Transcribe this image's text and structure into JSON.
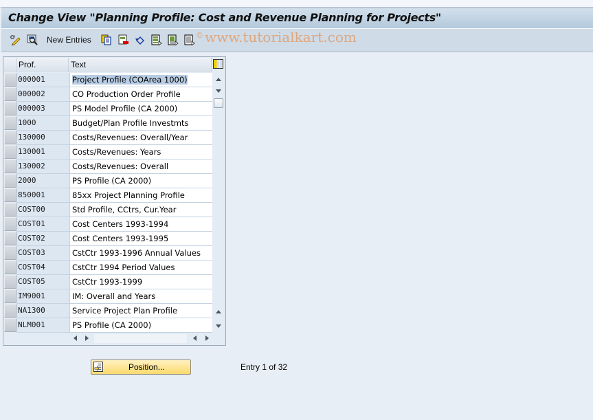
{
  "window": {
    "title": "Change View \"Planning Profile: Cost and Revenue Planning for Projects\""
  },
  "toolbar": {
    "icons": [
      "change-display-icon",
      "details-icon",
      "copy-as-icon",
      "delete-icon",
      "undo-change-icon",
      "select-all-icon",
      "select-block-icon",
      "deselect-all-icon"
    ],
    "new_entries_label": "New Entries",
    "watermark": "www.tutorialkart.com",
    "watermark_symbol": "©"
  },
  "table": {
    "columns": [
      {
        "key": "prof",
        "label": "Prof."
      },
      {
        "key": "text",
        "label": "Text"
      }
    ],
    "rows": [
      {
        "prof": "000001",
        "text": "Project Profile (COArea 1000)",
        "selected": true
      },
      {
        "prof": "000002",
        "text": "CO Production Order Profile"
      },
      {
        "prof": "000003",
        "text": "PS Model Profile (CA 2000)"
      },
      {
        "prof": "1000",
        "text": "Budget/Plan Profile Investmts"
      },
      {
        "prof": "130000",
        "text": "Costs/Revenues: Overall/Year"
      },
      {
        "prof": "130001",
        "text": "Costs/Revenues: Years"
      },
      {
        "prof": "130002",
        "text": "Costs/Revenues: Overall"
      },
      {
        "prof": "2000",
        "text": "PS Profile (CA 2000)"
      },
      {
        "prof": "850001",
        "text": "85xx Project Planning Profile"
      },
      {
        "prof": "COST00",
        "text": "Std Profile, CCtrs, Cur.Year"
      },
      {
        "prof": "COST01",
        "text": "Cost Centers 1993-1994"
      },
      {
        "prof": "COST02",
        "text": "Cost Centers 1993-1995"
      },
      {
        "prof": "COST03",
        "text": "CstCtr 1993-1996 Annual Values"
      },
      {
        "prof": "COST04",
        "text": "CstCtr 1994 Period Values"
      },
      {
        "prof": "COST05",
        "text": "CstCtr 1993-1999"
      },
      {
        "prof": "IM9001",
        "text": "IM: Overall and Years"
      },
      {
        "prof": "NA1300",
        "text": "Service Project Plan Profile"
      },
      {
        "prof": "NLM001",
        "text": "PS Profile (CA 2000)"
      }
    ]
  },
  "footer": {
    "position_button_label": "Position...",
    "entry_info": "Entry 1 of 32"
  }
}
